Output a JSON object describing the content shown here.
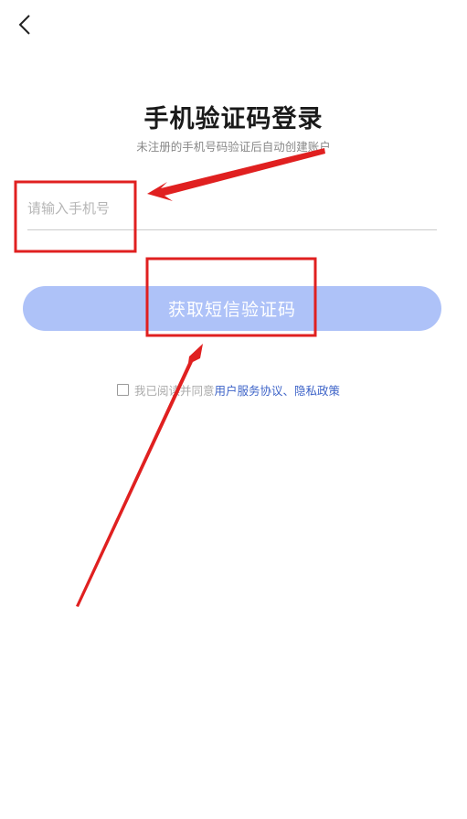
{
  "header": {
    "back_icon": "chevron-left-icon"
  },
  "login": {
    "title": "手机验证码登录",
    "subtitle": "未注册的手机号码验证后自动创建账户",
    "phone_placeholder": "请输入手机号",
    "phone_value": "",
    "submit_label": "获取短信验证码",
    "button_color": "#aec2f8"
  },
  "agreement": {
    "checked": false,
    "prefix": "我已阅读并同意",
    "user_agreement": "用户服务协议",
    "separator": "、",
    "privacy_policy": "隐私政策",
    "link_color": "#3e64c8"
  },
  "annotations": {
    "color": "#e02020"
  }
}
